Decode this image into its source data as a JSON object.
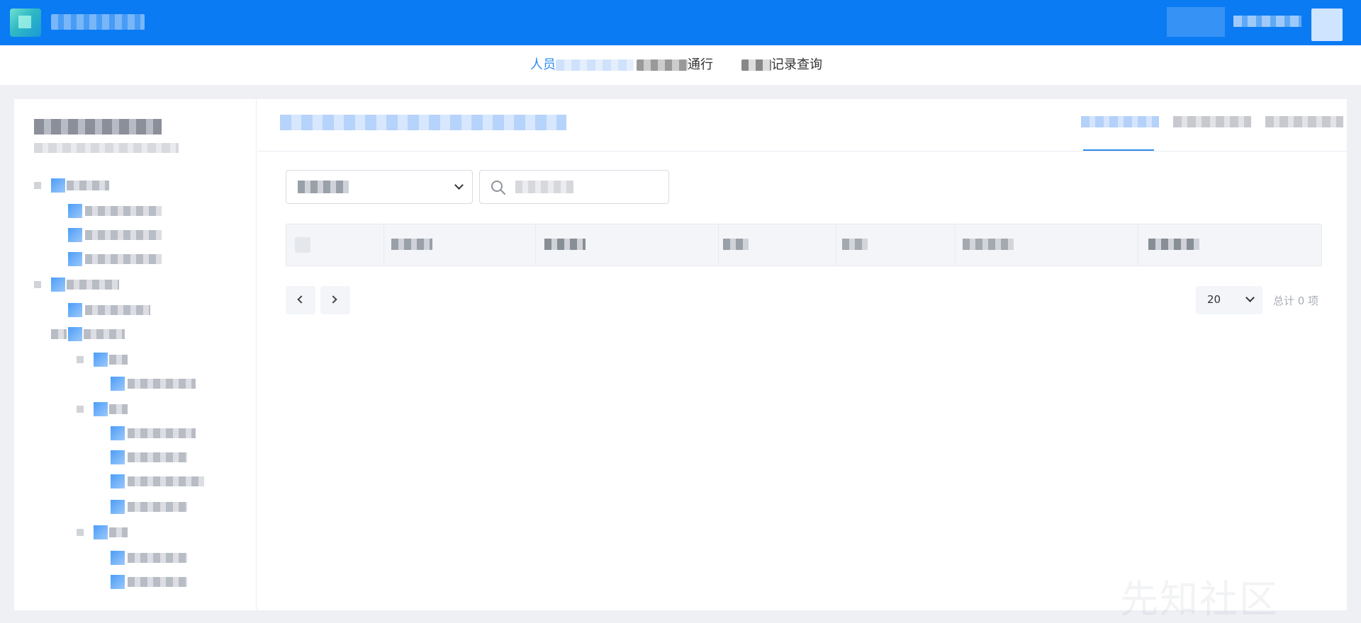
{
  "nav": {
    "tabs": [
      {
        "label": "人员",
        "active": true
      },
      {
        "label": "通行",
        "active": false
      },
      {
        "label": "记录查询",
        "active": false
      }
    ]
  },
  "toolbar": {
    "page_size": "20",
    "total_label": "总计 0 项"
  },
  "colors": {
    "topbar": "#0a7bf3",
    "accent": "#2d8cf0",
    "background": "#eef0f4"
  },
  "icons": [
    "logo-icon",
    "avatar-icon",
    "search-icon",
    "chevron-down-icon",
    "chevron-left-icon",
    "chevron-right-icon",
    "folder-icon"
  ],
  "watermark": "先知社区"
}
